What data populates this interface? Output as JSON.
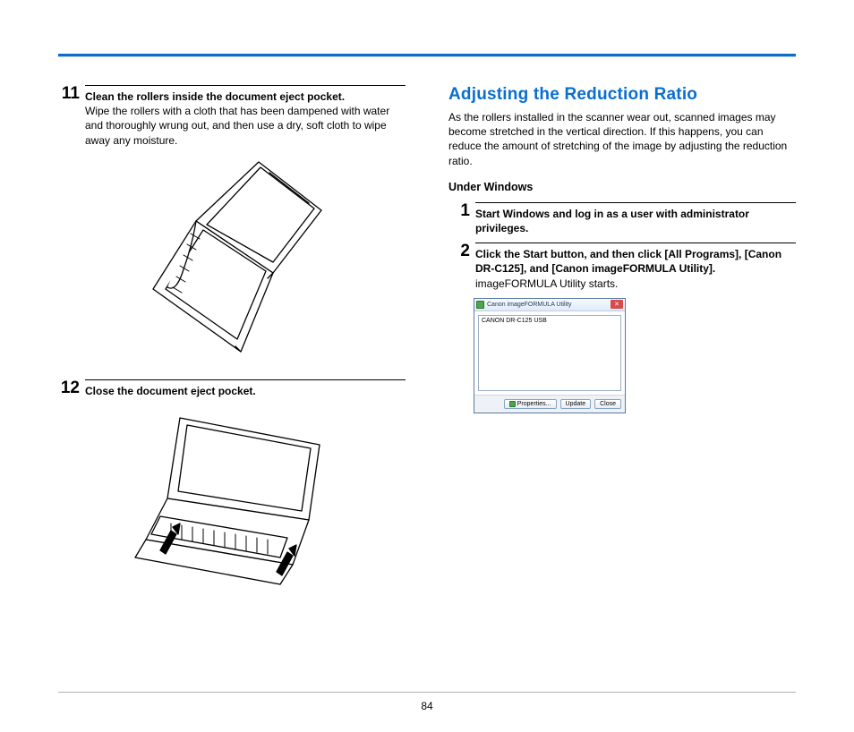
{
  "pageNumber": "84",
  "left": {
    "step11": {
      "num": "11",
      "title": "Clean the rollers inside the document eject pocket.",
      "body": "Wipe the rollers with a cloth that has been dampened with water and thoroughly wrung out, and then use a dry, soft cloth to wipe away any moisture."
    },
    "step12": {
      "num": "12",
      "title": "Close the document eject pocket."
    }
  },
  "right": {
    "sectionTitle": "Adjusting the Reduction Ratio",
    "intro": "As the rollers installed in the scanner wear out, scanned images may become stretched in the vertical direction. If this happens, you can reduce the amount of stretching of the image by adjusting the reduction ratio.",
    "underWindows": "Under Windows",
    "step1": {
      "num": "1",
      "title": "Start Windows and log in as a user with administrator privileges."
    },
    "step2": {
      "num": "2",
      "title": "Click the Start button, and then click [All Programs], [Canon DR-C125], and [Canon imageFORMULA Utility].",
      "body": "imageFORMULA Utility starts."
    },
    "dialog": {
      "title": "Canon imageFORMULA Utility",
      "listItem": "CANON DR-C125 USB",
      "btnProps": "Properties...",
      "btnUpdate": "Update",
      "btnClose": "Close",
      "x": "✕"
    }
  }
}
